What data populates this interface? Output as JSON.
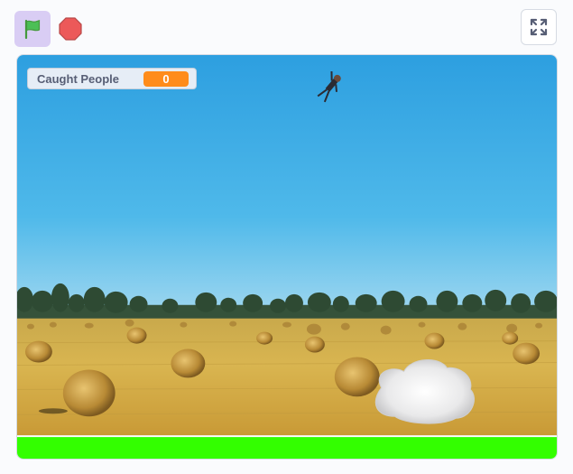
{
  "toolbar": {
    "green_flag": {
      "icon": "green-flag-icon",
      "color": "#4cbf56"
    },
    "stop": {
      "icon": "stop-sign-icon",
      "color": "#ec5959"
    },
    "fullscreen": {
      "icon": "fullscreen-icon"
    }
  },
  "stage": {
    "backdrop": "hay-bale-field",
    "ground_color": "#33ff00",
    "sprites": [
      "falling-person",
      "cloud-catcher"
    ],
    "monitor": {
      "label": "Caught People",
      "value": "0",
      "value_color": "#ff8c1a"
    }
  }
}
